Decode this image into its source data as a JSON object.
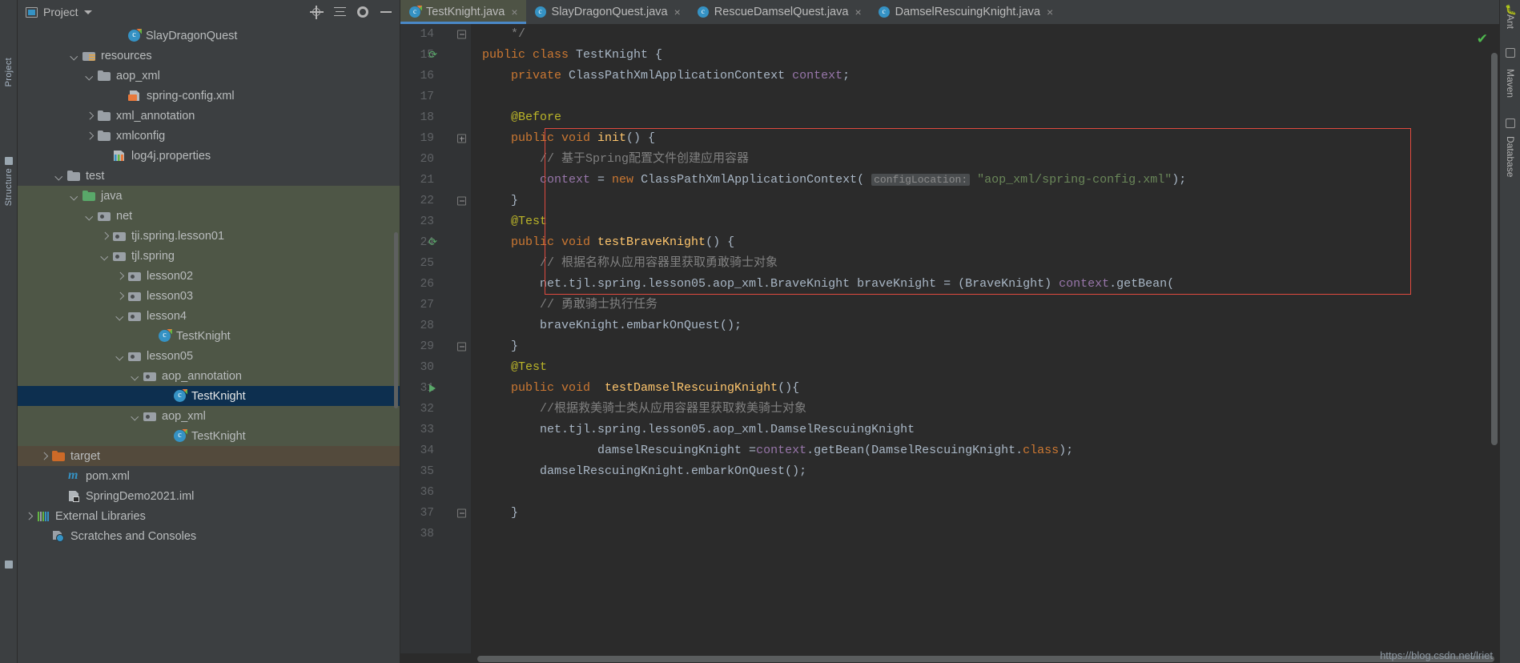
{
  "left_strip": {
    "labels": [
      "Project",
      "Structure"
    ]
  },
  "project_panel": {
    "title": "Project",
    "header_icons": [
      "project-icon",
      "chevron-down-icon",
      "locate-icon",
      "collapse-all-icon",
      "settings-gear-icon",
      "hide-icon"
    ],
    "tree": [
      {
        "indent": 6,
        "arrow": "none",
        "icon": "class-test-icon",
        "label": "SlayDragonQuest",
        "state": "normal"
      },
      {
        "indent": 3,
        "arrow": "down",
        "icon": "folder-resources",
        "label": "resources",
        "state": "normal"
      },
      {
        "indent": 4,
        "arrow": "down",
        "icon": "folder",
        "label": "aop_xml",
        "state": "normal"
      },
      {
        "indent": 6,
        "arrow": "none",
        "icon": "xml-spring-file",
        "label": "spring-config.xml",
        "state": "normal"
      },
      {
        "indent": 4,
        "arrow": "right",
        "icon": "folder",
        "label": "xml_annotation",
        "state": "normal"
      },
      {
        "indent": 4,
        "arrow": "right",
        "icon": "folder",
        "label": "xmlconfig",
        "state": "normal"
      },
      {
        "indent": 5,
        "arrow": "none",
        "icon": "properties-file",
        "label": "log4j.properties",
        "state": "normal"
      },
      {
        "indent": 2,
        "arrow": "down",
        "icon": "folder",
        "label": "test",
        "state": "normal"
      },
      {
        "indent": 3,
        "arrow": "down",
        "icon": "folder-green",
        "label": "java",
        "state": "green"
      },
      {
        "indent": 4,
        "arrow": "down",
        "icon": "folder-package",
        "label": "net",
        "state": "green"
      },
      {
        "indent": 5,
        "arrow": "right",
        "icon": "folder-package",
        "label": "tji.spring.lesson01",
        "state": "green"
      },
      {
        "indent": 5,
        "arrow": "down",
        "icon": "folder-package",
        "label": "tjl.spring",
        "state": "green"
      },
      {
        "indent": 6,
        "arrow": "right",
        "icon": "folder-package",
        "label": "lesson02",
        "state": "green"
      },
      {
        "indent": 6,
        "arrow": "right",
        "icon": "folder-package",
        "label": "lesson03",
        "state": "green"
      },
      {
        "indent": 6,
        "arrow": "down",
        "icon": "folder-package",
        "label": "lesson4",
        "state": "green"
      },
      {
        "indent": 8,
        "arrow": "none",
        "icon": "class-test-icon",
        "label": "TestKnight",
        "state": "green"
      },
      {
        "indent": 6,
        "arrow": "down",
        "icon": "folder-package",
        "label": "lesson05",
        "state": "green"
      },
      {
        "indent": 7,
        "arrow": "down",
        "icon": "folder-package",
        "label": "aop_annotation",
        "state": "green"
      },
      {
        "indent": 9,
        "arrow": "none",
        "icon": "class-test-icon",
        "label": "TestKnight",
        "state": "selected"
      },
      {
        "indent": 7,
        "arrow": "down",
        "icon": "folder-package",
        "label": "aop_xml",
        "state": "green"
      },
      {
        "indent": 9,
        "arrow": "none",
        "icon": "class-test-icon",
        "label": "TestKnight",
        "state": "green"
      },
      {
        "indent": 1,
        "arrow": "right",
        "icon": "folder-orange",
        "label": "target",
        "state": "brown"
      },
      {
        "indent": 2,
        "arrow": "none",
        "icon": "maven-icon",
        "label": "pom.xml",
        "state": "normal"
      },
      {
        "indent": 2,
        "arrow": "none",
        "icon": "iml-file-icon",
        "label": "SpringDemo2021.iml",
        "state": "normal"
      },
      {
        "indent": 0,
        "arrow": "right",
        "icon": "libraries-icon",
        "label": "External Libraries",
        "state": "normal"
      },
      {
        "indent": 1,
        "arrow": "none",
        "icon": "scratches-icon",
        "label": "Scratches and Consoles",
        "state": "normal"
      }
    ]
  },
  "editor": {
    "tabs": [
      {
        "label": "TestKnight.java",
        "active": true,
        "close": "×"
      },
      {
        "label": "SlayDragonQuest.java",
        "active": false,
        "close": "×"
      },
      {
        "label": "RescueDamselQuest.java",
        "active": false,
        "close": "×"
      },
      {
        "label": "DamselRescuingKnight.java",
        "active": false,
        "close": "×"
      }
    ],
    "inspection_ok": "✔",
    "lines": [
      {
        "num": "14",
        "gutter": "fold-collapse",
        "tokens": [
          {
            "t": "cmt",
            "v": "    */"
          }
        ]
      },
      {
        "num": "15",
        "gutter": "run-class",
        "tokens": [
          {
            "t": "kw",
            "v": "public class "
          },
          {
            "t": "pl",
            "v": "TestKnight {"
          }
        ]
      },
      {
        "num": "16",
        "gutter": "",
        "tokens": [
          {
            "t": "kw",
            "v": "    private "
          },
          {
            "t": "pl",
            "v": "ClassPathXmlApplicationContext "
          },
          {
            "t": "fld",
            "v": "context"
          },
          {
            "t": "pl",
            "v": ";"
          }
        ]
      },
      {
        "num": "17",
        "gutter": "",
        "tokens": [
          {
            "t": "pl",
            "v": ""
          }
        ]
      },
      {
        "num": "18",
        "gutter": "",
        "tokens": [
          {
            "t": "ann",
            "v": "    @Before"
          }
        ]
      },
      {
        "num": "19",
        "gutter": "fold-open",
        "tokens": [
          {
            "t": "kw",
            "v": "    public void "
          },
          {
            "t": "fn",
            "v": "init"
          },
          {
            "t": "pl",
            "v": "() {"
          }
        ]
      },
      {
        "num": "20",
        "gutter": "",
        "tokens": [
          {
            "t": "cmt",
            "v": "        // 基于Spring配置文件创建应用容器"
          }
        ]
      },
      {
        "num": "21",
        "gutter": "",
        "tokens": [
          {
            "t": "pl",
            "v": "        "
          },
          {
            "t": "fld",
            "v": "context"
          },
          {
            "t": "pl",
            "v": " = "
          },
          {
            "t": "kw",
            "v": "new "
          },
          {
            "t": "pl",
            "v": "ClassPathXmlApplicationContext( "
          },
          {
            "t": "hint",
            "v": "configLocation:"
          },
          {
            "t": "pl",
            "v": " "
          },
          {
            "t": "str",
            "v": "\"aop_xml/spring-config.xml\""
          },
          {
            "t": "pl",
            "v": ");"
          }
        ]
      },
      {
        "num": "22",
        "gutter": "fold-end",
        "tokens": [
          {
            "t": "pl",
            "v": "    }"
          }
        ]
      },
      {
        "num": "23",
        "gutter": "",
        "tokens": [
          {
            "t": "ann",
            "v": "    @Test"
          }
        ]
      },
      {
        "num": "24",
        "gutter": "run-method",
        "tokens": [
          {
            "t": "kw",
            "v": "    public void "
          },
          {
            "t": "fn",
            "v": "testBraveKnight"
          },
          {
            "t": "pl",
            "v": "() {"
          }
        ]
      },
      {
        "num": "25",
        "gutter": "",
        "tokens": [
          {
            "t": "cmt",
            "v": "        // 根据名称从应用容器里获取勇敢骑士对象"
          }
        ]
      },
      {
        "num": "26",
        "gutter": "",
        "tokens": [
          {
            "t": "pl",
            "v": "        net.tjl.spring.lesson05.aop_xml.BraveKnight braveKnight = (BraveKnight) "
          },
          {
            "t": "fld2",
            "v": "context"
          },
          {
            "t": "pl",
            "v": ".getBean("
          }
        ]
      },
      {
        "num": "27",
        "gutter": "",
        "tokens": [
          {
            "t": "cmt",
            "v": "        // 勇敢骑士执行任务"
          }
        ]
      },
      {
        "num": "28",
        "gutter": "",
        "tokens": [
          {
            "t": "pl",
            "v": "        braveKnight.embarkOnQuest();"
          }
        ]
      },
      {
        "num": "29",
        "gutter": "fold-end",
        "tokens": [
          {
            "t": "pl",
            "v": "    }"
          }
        ]
      },
      {
        "num": "30",
        "gutter": "",
        "tokens": [
          {
            "t": "ann",
            "v": "    @Test"
          }
        ]
      },
      {
        "num": "31",
        "gutter": "run-play",
        "tokens": [
          {
            "t": "kw",
            "v": "    public void  "
          },
          {
            "t": "fn",
            "v": "testDamselRescuingKnight"
          },
          {
            "t": "pl",
            "v": "(){"
          }
        ]
      },
      {
        "num": "32",
        "gutter": "",
        "tokens": [
          {
            "t": "cmt",
            "v": "        //根据救美骑士类从应用容器里获取救美骑士对象"
          }
        ]
      },
      {
        "num": "33",
        "gutter": "",
        "tokens": [
          {
            "t": "pl",
            "v": "        net.tjl.spring.lesson05.aop_xml.DamselRescuingKnight"
          }
        ]
      },
      {
        "num": "34",
        "gutter": "",
        "tokens": [
          {
            "t": "pl",
            "v": "                damselRescuingKnight ="
          },
          {
            "t": "fld2",
            "v": "context"
          },
          {
            "t": "pl",
            "v": ".getBean(DamselRescuingKnight."
          },
          {
            "t": "kw",
            "v": "class"
          },
          {
            "t": "pl",
            "v": ");"
          }
        ]
      },
      {
        "num": "35",
        "gutter": "",
        "tokens": [
          {
            "t": "pl",
            "v": "        damselRescuingKnight.embarkOnQuest();"
          }
        ]
      },
      {
        "num": "36",
        "gutter": "",
        "tokens": [
          {
            "t": "pl",
            "v": ""
          }
        ]
      },
      {
        "num": "37",
        "gutter": "fold-end",
        "tokens": [
          {
            "t": "pl",
            "v": "    }"
          }
        ]
      },
      {
        "num": "38",
        "gutter": "",
        "tokens": [
          {
            "t": "pl",
            "v": ""
          }
        ]
      }
    ]
  },
  "right_strip": {
    "labels": [
      "Ant",
      "Maven",
      "Database"
    ],
    "bug_icon": "bug-icon"
  },
  "watermark": "https://blog.csdn.net/lriet",
  "colors": {
    "selection_blue": "#0d2f4f",
    "module_green": "#4e5646",
    "excluded_brown": "#534a3c",
    "accent_blue": "#4a88c7",
    "red_highlight": "#e04a3f",
    "editor_bg": "#2b2b2b",
    "panel_bg": "#3c3f41"
  }
}
